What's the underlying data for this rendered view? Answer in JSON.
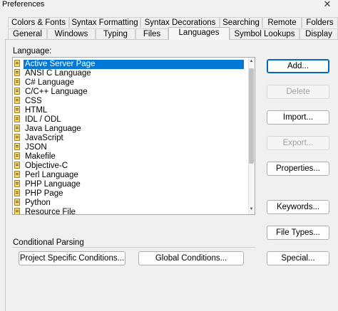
{
  "window": {
    "title": "Preferences",
    "close_glyph": "✕"
  },
  "tabs_row1": [
    {
      "label": "Colors & Fonts"
    },
    {
      "label": "Syntax Formatting"
    },
    {
      "label": "Syntax Decorations"
    },
    {
      "label": "Searching"
    },
    {
      "label": "Remote"
    },
    {
      "label": "Folders"
    }
  ],
  "tabs_row2": [
    {
      "label": "General"
    },
    {
      "label": "Windows"
    },
    {
      "label": "Typing"
    },
    {
      "label": "Files"
    },
    {
      "label": "Languages",
      "active": true
    },
    {
      "label": "Symbol Lookups"
    },
    {
      "label": "Display"
    }
  ],
  "language_label": "Language:",
  "languages": [
    "Active Server Page",
    "ANSI C Language",
    "C# Language",
    "C/C++ Language",
    "CSS",
    "HTML",
    "IDL / ODL",
    "Java Language",
    "JavaScript",
    "JSON",
    "Makefile",
    "Objective-C",
    "Perl Language",
    "PHP Language",
    "PHP Page",
    "Python",
    "Resource File"
  ],
  "selected_language": "Active Server Page",
  "buttons": {
    "add": "Add...",
    "delete": "Delete",
    "import": "Import...",
    "export": "Export...",
    "properties": "Properties...",
    "keywords": "Keywords...",
    "file_types": "File Types...",
    "special": "Special..."
  },
  "conditional": {
    "label": "Conditional Parsing",
    "project_button": "Project Specific Conditions...",
    "global_button": "Global Conditions..."
  },
  "icons": {
    "language_item": "language-file-icon",
    "scroll_up": "▲",
    "scroll_down": "▼"
  }
}
